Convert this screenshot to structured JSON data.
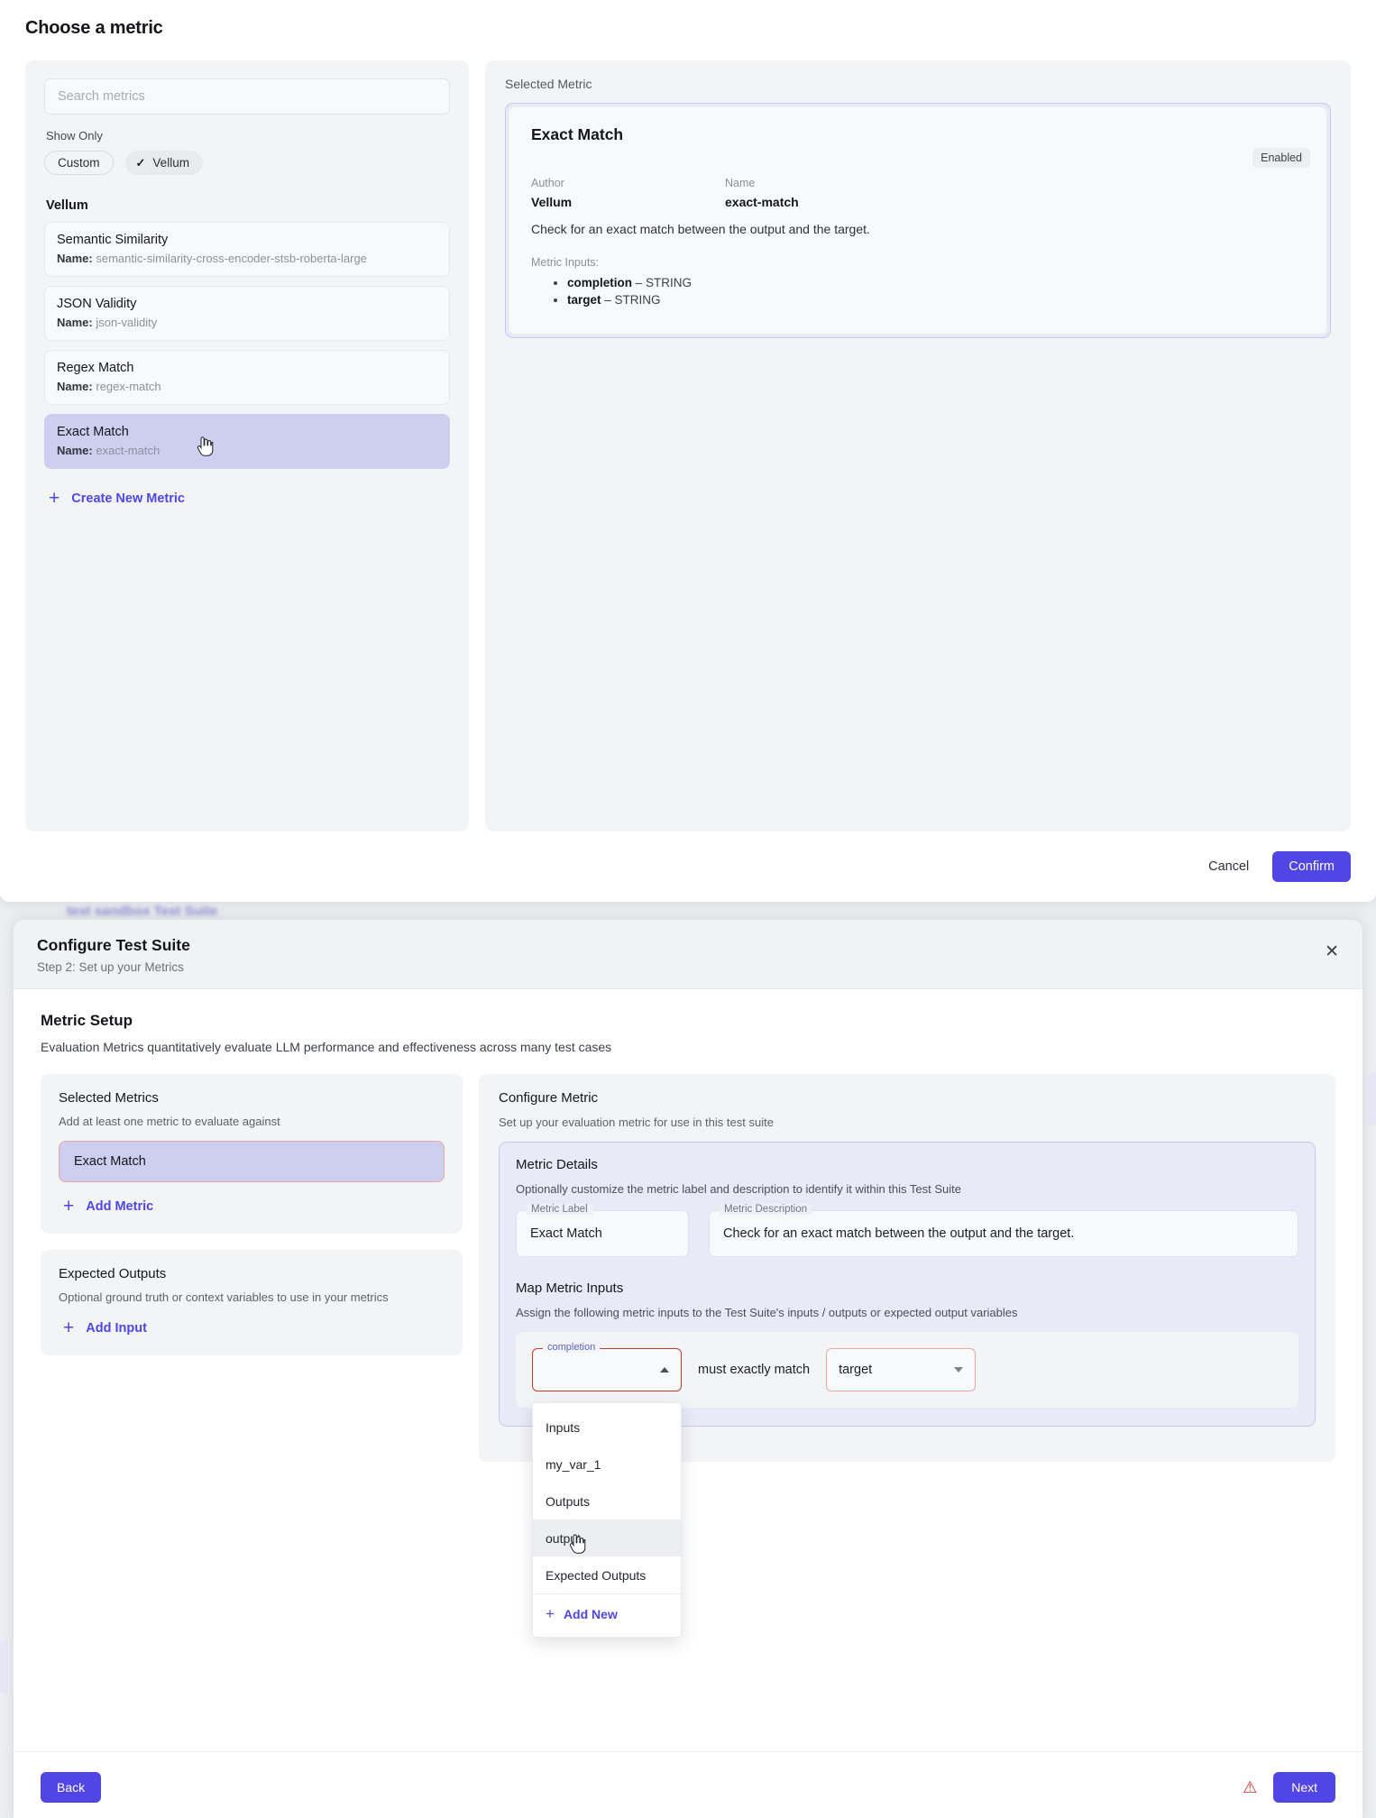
{
  "top_modal": {
    "title": "Choose a metric",
    "search": {
      "placeholder": "Search metrics",
      "value": ""
    },
    "show_only_label": "Show Only",
    "chips": [
      {
        "label": "Custom",
        "active": false
      },
      {
        "label": "Vellum",
        "active": true,
        "tick": "✓"
      }
    ],
    "group_label": "Vellum",
    "metrics": [
      {
        "title": "Semantic Similarity",
        "name_label": "Name:",
        "name": "semantic-similarity-cross-encoder-stsb-roberta-large",
        "selected": false
      },
      {
        "title": "JSON Validity",
        "name_label": "Name:",
        "name": "json-validity",
        "selected": false
      },
      {
        "title": "Regex Match",
        "name_label": "Name:",
        "name": "regex-match",
        "selected": false
      },
      {
        "title": "Exact Match",
        "name_label": "Name:",
        "name": "exact-match",
        "selected": true
      }
    ],
    "create_new_metric": "Create New Metric",
    "selected_metric_label": "Selected Metric",
    "detail": {
      "title": "Exact Match",
      "badge": "Enabled",
      "author_label": "Author",
      "author": "Vellum",
      "name_label": "Name",
      "name": "exact-match",
      "description": "Check for an exact match between the output and the target.",
      "metric_inputs_label": "Metric Inputs:",
      "inputs": [
        {
          "name": "completion",
          "type": "STRING"
        },
        {
          "name": "target",
          "type": "STRING"
        }
      ]
    },
    "cancel": "Cancel",
    "confirm": "Confirm"
  },
  "ghost_line": "test sandbox Test Suite",
  "bottom_modal": {
    "title": "Configure Test Suite",
    "step": "Step 2: Set up your Metrics",
    "close": "✕",
    "section_title": "Metric Setup",
    "section_sub": "Evaluation Metrics quantitatively evaluate LLM performance and effectiveness across many test cases",
    "selected_metrics": {
      "title": "Selected Metrics",
      "sub": "Add at least one metric to evaluate against",
      "items": [
        {
          "label": "Exact Match"
        }
      ],
      "add_label": "Add Metric"
    },
    "expected_outputs": {
      "title": "Expected Outputs",
      "sub": "Optional ground truth or context variables to use in your metrics",
      "add_label": "Add Input"
    },
    "configure_metric": {
      "title": "Configure Metric",
      "sub": "Set up your evaluation metric for use in this test suite",
      "details_title": "Metric Details",
      "details_sub": "Optionally customize the metric label and description to identify it within this Test Suite",
      "metric_label_legend": "Metric Label",
      "metric_label_value": "Exact Match",
      "metric_desc_legend": "Metric Description",
      "metric_desc_value": "Check for an exact match between the output and the target.",
      "map_title": "Map Metric Inputs",
      "map_sub": "Assign the following metric inputs to the Test Suite's inputs / outputs or expected output variables",
      "left_select": {
        "legend": "completion",
        "value": ""
      },
      "mid_text": "must exactly match",
      "right_select": {
        "value": "target"
      },
      "dropdown_options": [
        {
          "label": "Inputs",
          "kind": "group",
          "hover": false
        },
        {
          "label": "my_var_1",
          "kind": "option",
          "hover": false
        },
        {
          "label": "Outputs",
          "kind": "group",
          "hover": false
        },
        {
          "label": "output",
          "kind": "option",
          "hover": true
        },
        {
          "label": "Expected Outputs",
          "kind": "group",
          "hover": false
        }
      ],
      "dropdown_add": "Add New"
    },
    "back": "Back",
    "next": "Next",
    "warning_icon": "⚠"
  },
  "colors": {
    "accent": "#4f46e5",
    "selected_fill": "#cdcef0",
    "error_border": "#c8372b",
    "soft_error_border": "#e8a9a2",
    "panel_bg": "#f3f4f6"
  }
}
